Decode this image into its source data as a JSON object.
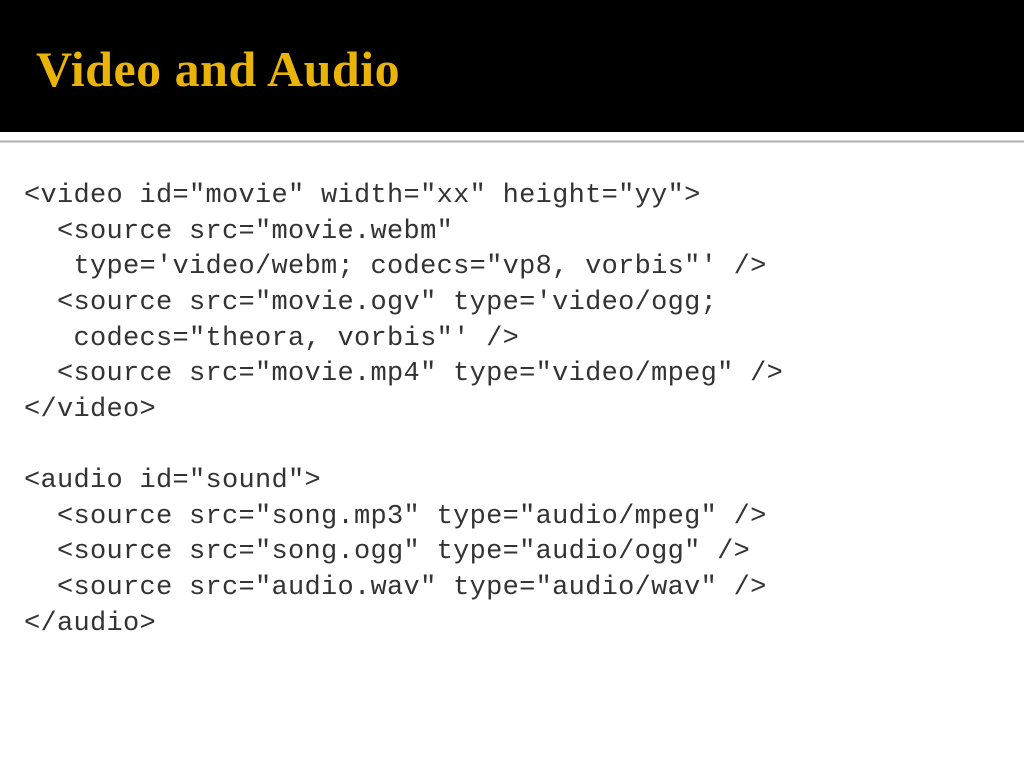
{
  "title": "Video and Audio",
  "codeLines": [
    "<video id=\"movie\" width=\"xx\" height=\"yy\">",
    "  <source src=\"movie.webm\"",
    "   type='video/webm; codecs=\"vp8, vorbis\"' />",
    "  <source src=\"movie.ogv\" type='video/ogg;",
    "   codecs=\"theora, vorbis\"' />",
    "  <source src=\"movie.mp4\" type=\"video/mpeg\" />",
    "</video>",
    "",
    "<audio id=\"sound\">",
    "  <source src=\"song.mp3\" type=\"audio/mpeg\" />",
    "  <source src=\"song.ogg\" type=\"audio/ogg\" />",
    "  <source src=\"audio.wav\" type=\"audio/wav\" />",
    "</audio>"
  ]
}
